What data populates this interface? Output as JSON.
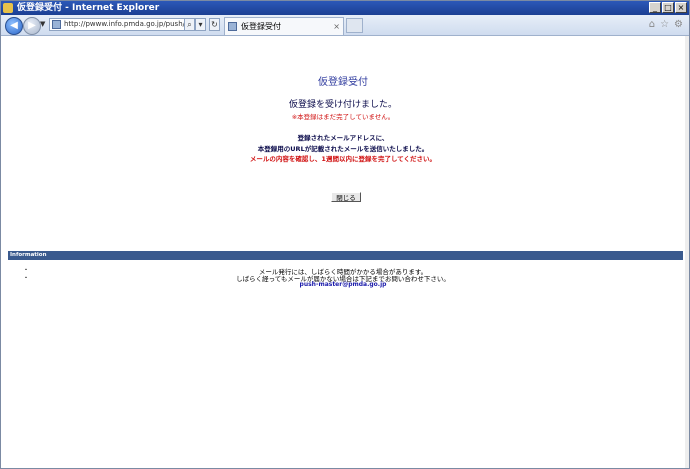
{
  "window": {
    "title": "仮登録受付 - Internet Explorer",
    "min_btn": "_",
    "max_btn": "□",
    "close_btn": "×"
  },
  "browser": {
    "address": "http://pwww.info.pmda.go.jp/push/jsp/",
    "tab_title": "仮登録受付",
    "tab_close": "×"
  },
  "page": {
    "title": "仮登録受付",
    "received": "仮登録を受け付けました。",
    "warning": "※本登録はまだ完了していません。",
    "msg1": "登録されたメールアドレスに、",
    "msg2": "本登録用のURLが記載されたメールを送信いたしました。",
    "msg3": "メールの内容を確認し、1週間以内に登録を完了してください。",
    "close_label": "閉じる"
  },
  "information": {
    "header": "Information",
    "line1": "メール発行には、しばらく時間がかかる場合があります。",
    "line2": "しばらく経ってもメールが届かない場合は下記までお問い合わせ下さい。",
    "email": "push-master@pmda.go.jp"
  }
}
